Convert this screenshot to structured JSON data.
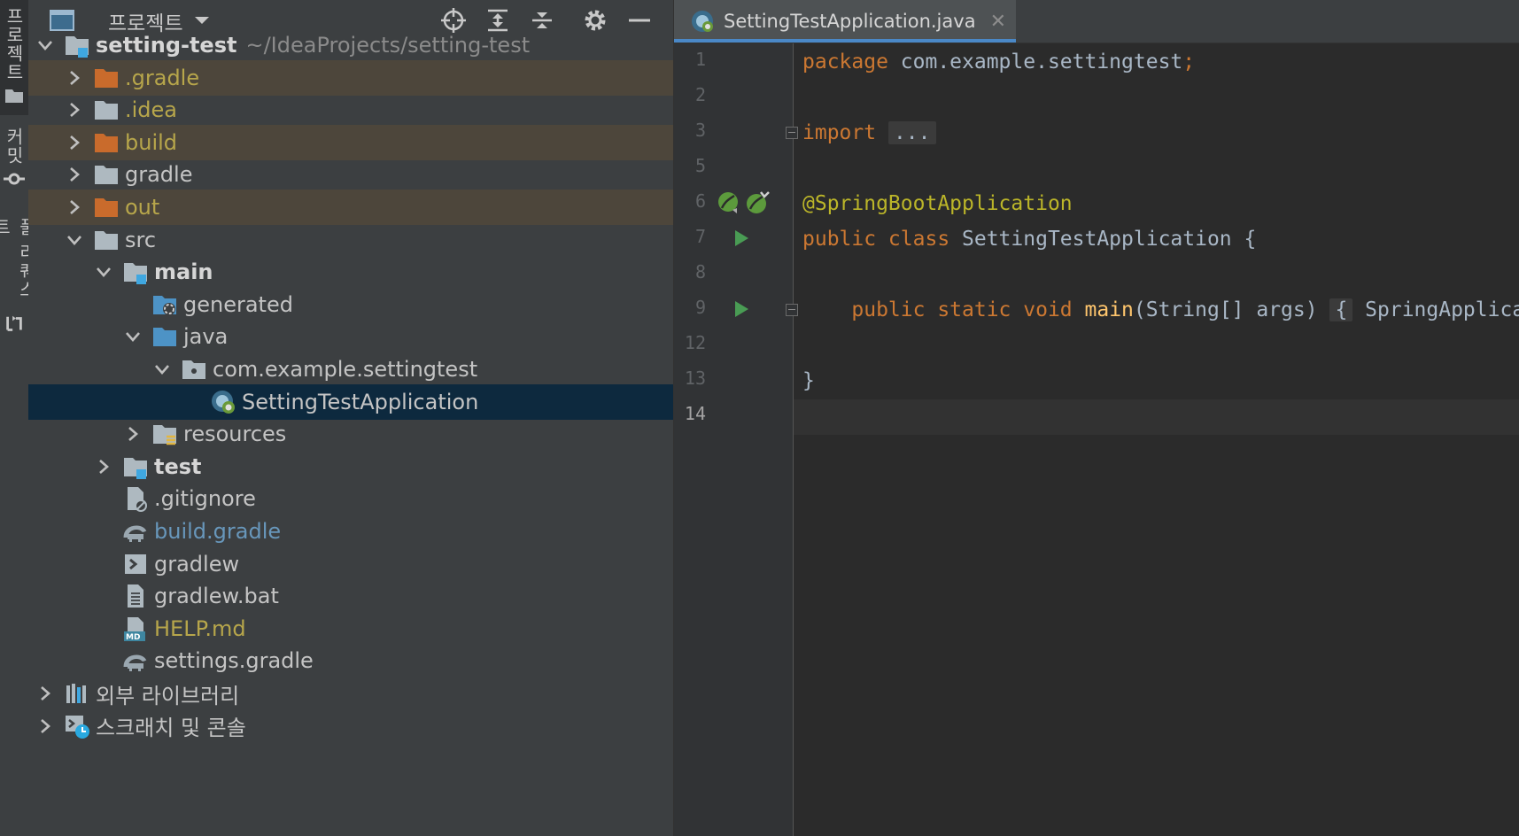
{
  "left_strip": {
    "tabs": [
      {
        "label": "프로젝트",
        "icon": "folder-icon",
        "active": true
      },
      {
        "label": "커밋",
        "icon": "commit-icon",
        "active": false
      },
      {
        "label": "풀 리퀘스트",
        "icon": "pull-request-icon",
        "active": false
      }
    ]
  },
  "project_panel": {
    "title": "프로젝트",
    "toolbar_icons": [
      "locate-icon",
      "expand-all-icon",
      "collapse-all-icon",
      "settings-icon",
      "minimize-icon"
    ],
    "tree": [
      {
        "depth": 0,
        "arrow": "down",
        "icon": "module-folder-icon",
        "label": "setting-test",
        "hint": "~/IdeaProjects/setting-test",
        "style": "bold"
      },
      {
        "depth": 1,
        "arrow": "right",
        "icon": "excluded-folder-icon",
        "label": ".gradle",
        "style": "excluded"
      },
      {
        "depth": 1,
        "arrow": "right",
        "icon": "folder-icon",
        "label": ".idea",
        "style": "excluded-text"
      },
      {
        "depth": 1,
        "arrow": "right",
        "icon": "excluded-folder-icon",
        "label": "build",
        "style": "excluded"
      },
      {
        "depth": 1,
        "arrow": "right",
        "icon": "folder-icon",
        "label": "gradle",
        "style": "normal"
      },
      {
        "depth": 1,
        "arrow": "right",
        "icon": "excluded-folder-icon",
        "label": "out",
        "style": "excluded"
      },
      {
        "depth": 1,
        "arrow": "down",
        "icon": "folder-icon",
        "label": "src",
        "style": "normal"
      },
      {
        "depth": 2,
        "arrow": "down",
        "icon": "module-folder-icon",
        "label": "main",
        "style": "bold"
      },
      {
        "depth": 3,
        "arrow": "none",
        "icon": "generated-folder-icon",
        "label": "generated",
        "style": "normal"
      },
      {
        "depth": 3,
        "arrow": "down",
        "icon": "source-folder-icon",
        "label": "java",
        "style": "normal"
      },
      {
        "depth": 4,
        "arrow": "down",
        "icon": "package-icon",
        "label": "com.example.settingtest",
        "style": "normal"
      },
      {
        "depth": 5,
        "arrow": "none",
        "icon": "spring-class-icon",
        "label": "SettingTestApplication",
        "style": "selected"
      },
      {
        "depth": 3,
        "arrow": "right",
        "icon": "resources-folder-icon",
        "label": "resources",
        "style": "normal"
      },
      {
        "depth": 2,
        "arrow": "right",
        "icon": "module-folder-icon",
        "label": "test",
        "style": "bold"
      },
      {
        "depth": 2,
        "arrow": "none",
        "icon": "gitignore-file-icon",
        "label": ".gitignore",
        "style": "normal"
      },
      {
        "depth": 2,
        "arrow": "none",
        "icon": "gradle-file-icon",
        "label": "build.gradle",
        "style": "blue"
      },
      {
        "depth": 2,
        "arrow": "none",
        "icon": "shell-file-icon",
        "label": "gradlew",
        "style": "normal"
      },
      {
        "depth": 2,
        "arrow": "none",
        "icon": "text-file-icon",
        "label": "gradlew.bat",
        "style": "normal"
      },
      {
        "depth": 2,
        "arrow": "none",
        "icon": "markdown-file-icon",
        "label": "HELP.md",
        "style": "excluded-text"
      },
      {
        "depth": 2,
        "arrow": "none",
        "icon": "gradle-file-icon",
        "label": "settings.gradle",
        "style": "normal"
      },
      {
        "depth": 0,
        "arrow": "right",
        "icon": "libraries-icon",
        "label": "외부 라이브러리",
        "style": "normal"
      },
      {
        "depth": 0,
        "arrow": "right",
        "icon": "scratches-icon",
        "label": "스크래치 및 콘솔",
        "style": "normal"
      }
    ]
  },
  "editor": {
    "tab": {
      "label": "SettingTestApplication.java",
      "icon": "spring-class-icon",
      "close": "✕"
    },
    "lines": [
      {
        "num": "1",
        "tokens": [
          {
            "t": "package",
            "c": "kw"
          },
          {
            "t": " com.example.settingtest",
            "c": ""
          },
          {
            "t": ";",
            "c": "kw"
          }
        ]
      },
      {
        "num": "2",
        "tokens": []
      },
      {
        "num": "3",
        "fold": true,
        "tokens": [
          {
            "t": "import",
            "c": "kw"
          },
          {
            "t": " ",
            "c": ""
          },
          {
            "t": "...",
            "c": "foldbox"
          }
        ]
      },
      {
        "num": "5",
        "tokens": []
      },
      {
        "num": "6",
        "gutter": "spring-bean-icons",
        "tokens": [
          {
            "t": "@SpringBootApplication",
            "c": "ann"
          }
        ]
      },
      {
        "num": "7",
        "gutter": "run-icon",
        "tokens": [
          {
            "t": "public class",
            "c": "kw"
          },
          {
            "t": " SettingTestApplication {",
            "c": ""
          }
        ]
      },
      {
        "num": "8",
        "tokens": []
      },
      {
        "num": "9",
        "gutter": "run-icon",
        "fold": true,
        "tokens": [
          {
            "t": "    ",
            "c": ""
          },
          {
            "t": "public static void",
            "c": "kw"
          },
          {
            "t": " ",
            "c": ""
          },
          {
            "t": "main",
            "c": "fn"
          },
          {
            "t": "(String[] args) ",
            "c": ""
          },
          {
            "t": "{",
            "c": "foldbox"
          },
          {
            "t": " SpringApplica",
            "c": ""
          }
        ]
      },
      {
        "num": "12",
        "tokens": []
      },
      {
        "num": "13",
        "tokens": [
          {
            "t": "}",
            "c": ""
          }
        ]
      },
      {
        "num": "14",
        "current": true,
        "tokens": []
      }
    ]
  },
  "colors": {
    "accent": "#4a88c7",
    "selection": "#0d293e",
    "excluded_row": "#4d463b",
    "keyword": "#cc7832",
    "annotation": "#bbb529",
    "function": "#ffc66d"
  }
}
